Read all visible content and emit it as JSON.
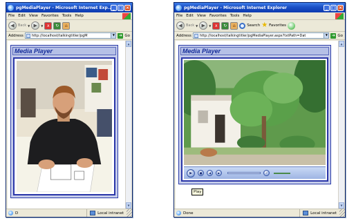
{
  "windows": [
    {
      "title": "pgMediaPlayer - Microsoft Internet Exp...",
      "menu": [
        "File",
        "Edit",
        "View",
        "Favorites",
        "Tools",
        "Help"
      ],
      "toolbar": {
        "back": "Back"
      },
      "address_label": "Address",
      "address_value": "http://localhost/talkingtitler/pgM",
      "go_label": "Go",
      "panel_title": "Media Player",
      "status_left": "D",
      "status_zone": "Local intranet"
    },
    {
      "title": "pgMediaPlayer - Microsoft Internet Explorer",
      "menu": [
        "File",
        "Edit",
        "View",
        "Favorites",
        "Tools",
        "Help"
      ],
      "toolbar": {
        "back": "Back",
        "search": "Search",
        "favorites": "Favorites"
      },
      "address_label": "Address",
      "address_value": "http://localhost/talkingtitler/pgMediaPlayer.aspx?txtPath=Dat",
      "go_label": "Go",
      "panel_title": "Media Player",
      "tooltip": "Play",
      "status_left": "Done",
      "status_zone": "Local intranet"
    }
  ],
  "icons": {
    "window_buttons": [
      "minimize-icon",
      "maximize-icon",
      "close-icon"
    ],
    "toolbar": [
      "back-icon",
      "forward-icon",
      "stop-icon",
      "refresh-icon",
      "home-icon",
      "search-icon",
      "favorites-icon",
      "media-icon"
    ],
    "player_controls": [
      "play-icon",
      "stop-icon",
      "previous-icon",
      "next-icon",
      "mute-icon"
    ]
  },
  "colors": {
    "titlebar": "#0c3ab0",
    "panel_title": "#152c9a",
    "panel_border": "#2b3ca8",
    "panel_fill": "#c6cdeb"
  }
}
